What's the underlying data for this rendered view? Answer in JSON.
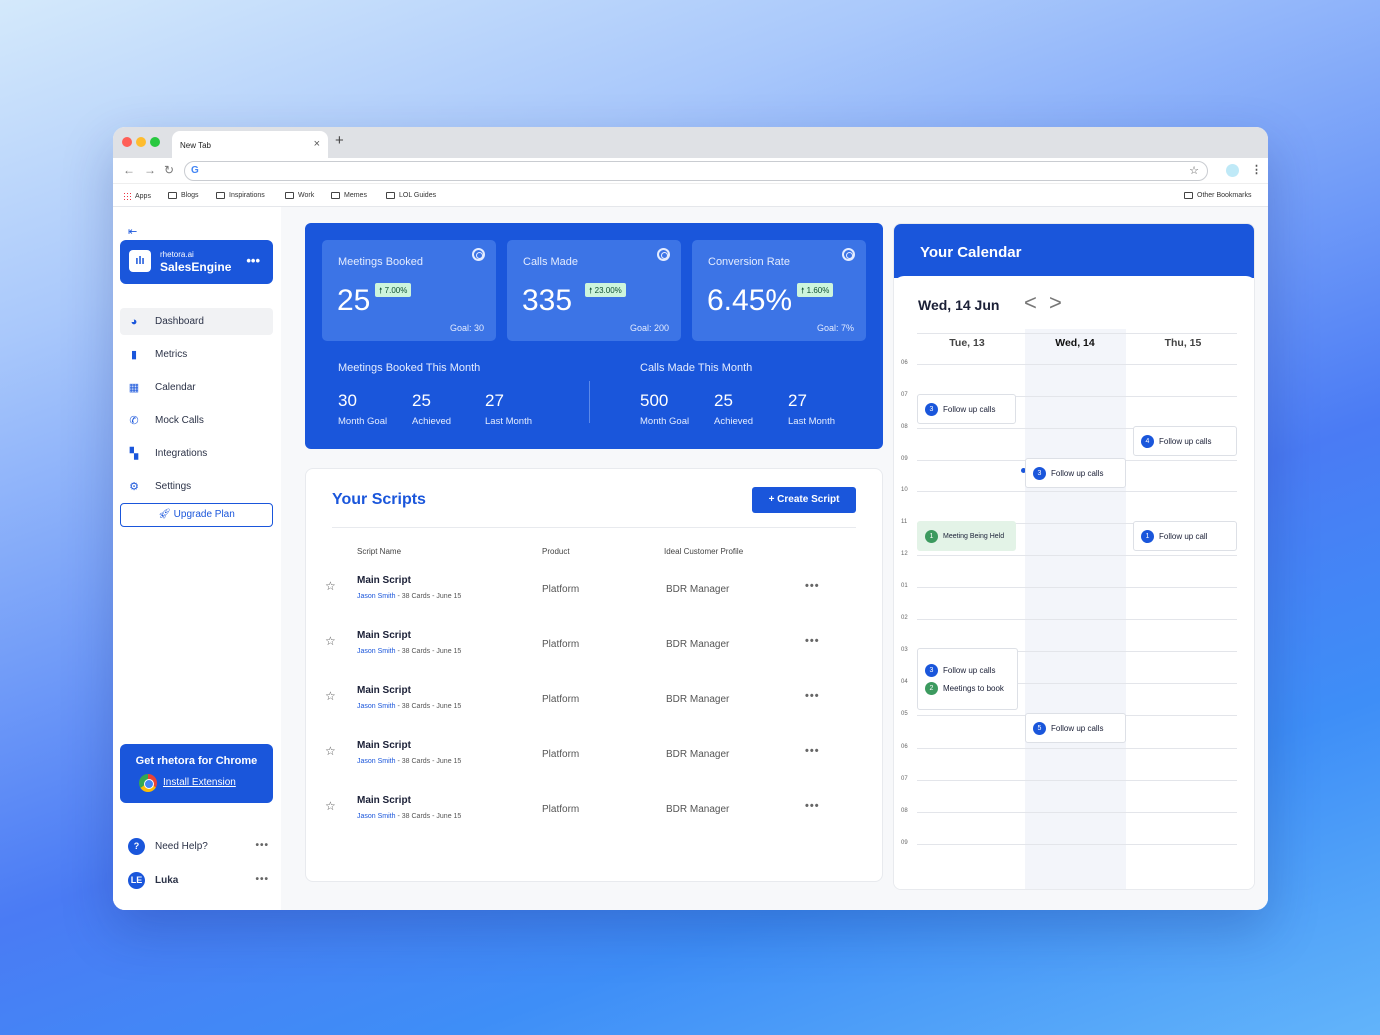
{
  "browser": {
    "tab_title": "New Tab",
    "tab_close": "×",
    "new_tab": "+",
    "url_value": "",
    "bookmarks": [
      "Apps",
      "Blogs",
      "Inspirations",
      "Work",
      "Memes",
      "LOL Guides"
    ],
    "other_bookmarks": "Other Bookmarks"
  },
  "sidebar": {
    "brand_sub": "rhetora.ai",
    "brand_name": "SalesEngine",
    "items": [
      {
        "label": "Dashboard",
        "icon": "dashboard-icon"
      },
      {
        "label": "Metrics",
        "icon": "bar-chart-icon"
      },
      {
        "label": "Calendar",
        "icon": "calendar-icon"
      },
      {
        "label": "Mock Calls",
        "icon": "phone-icon"
      },
      {
        "label": "Integrations",
        "icon": "grid-icon"
      },
      {
        "label": "Settings",
        "icon": "gear-icon"
      }
    ],
    "upgrade": "Upgrade Plan",
    "chrome_title": "Get rhetora for Chrome",
    "chrome_link": "Install Extension",
    "help": "Need Help?",
    "user_initials": "LE",
    "user_name": "Luka"
  },
  "stats": {
    "cards": [
      {
        "label": "Meetings Booked",
        "value": "25",
        "badge": "7.00%",
        "goal": "Goal: 30"
      },
      {
        "label": "Calls Made",
        "value": "335",
        "badge": "23.00%",
        "goal": "Goal: 200"
      },
      {
        "label": "Conversion Rate",
        "value": "6.45%",
        "badge": "1.60%",
        "goal": "Goal: 7%"
      }
    ],
    "meetings_month": {
      "title": "Meetings Booked This Month",
      "values": [
        {
          "n": "30",
          "l": "Month Goal"
        },
        {
          "n": "25",
          "l": "Achieved"
        },
        {
          "n": "27",
          "l": "Last Month"
        }
      ]
    },
    "calls_month": {
      "title": "Calls Made This Month",
      "values": [
        {
          "n": "500",
          "l": "Month Goal"
        },
        {
          "n": "25",
          "l": "Achieved"
        },
        {
          "n": "27",
          "l": "Last Month"
        }
      ]
    }
  },
  "scripts": {
    "title": "Your Scripts",
    "create": "+ Create Script",
    "headers": [
      "Script Name",
      "Product",
      "Ideal Customer Profile"
    ],
    "rows": [
      {
        "name": "Main Script",
        "author": "Jason Smith",
        "cards": "38 Cards",
        "date": "June 15",
        "product": "Platform",
        "icp": "BDR Manager"
      },
      {
        "name": "Main Script",
        "author": "Jason Smith",
        "cards": "38 Cards",
        "date": "June 15",
        "product": "Platform",
        "icp": "BDR Manager"
      },
      {
        "name": "Main Script",
        "author": "Jason Smith",
        "cards": "38 Cards",
        "date": "June 15",
        "product": "Platform",
        "icp": "BDR Manager"
      },
      {
        "name": "Main Script",
        "author": "Jason Smith",
        "cards": "38 Cards",
        "date": "June 15",
        "product": "Platform",
        "icp": "BDR Manager"
      },
      {
        "name": "Main Script",
        "author": "Jason Smith",
        "cards": "38 Cards",
        "date": "June 15",
        "product": "Platform",
        "icp": "BDR Manager"
      }
    ]
  },
  "calendar": {
    "title": "Your Calendar",
    "date": "Wed, 14 Jun",
    "prev": "<",
    "next": ">",
    "days": [
      "Tue, 13",
      "Wed, 14",
      "Thu, 15"
    ],
    "hours": [
      "06",
      "07",
      "08",
      "09",
      "10",
      "11",
      "12",
      "01",
      "02",
      "03",
      "04",
      "05",
      "06",
      "07",
      "08",
      "09"
    ],
    "events": [
      {
        "n": "3",
        "label": "Follow up calls"
      },
      {
        "n": "4",
        "label": "Follow up calls"
      },
      {
        "n": "3",
        "label": "Follow up calls"
      },
      {
        "n": "1",
        "label": "Meeting Being Held"
      },
      {
        "n": "1",
        "label": "Follow up call"
      },
      {
        "n": "3",
        "label": "Follow up calls"
      },
      {
        "n": "2",
        "label": "Meetings to book"
      },
      {
        "n": "5",
        "label": "Follow up calls"
      }
    ]
  }
}
